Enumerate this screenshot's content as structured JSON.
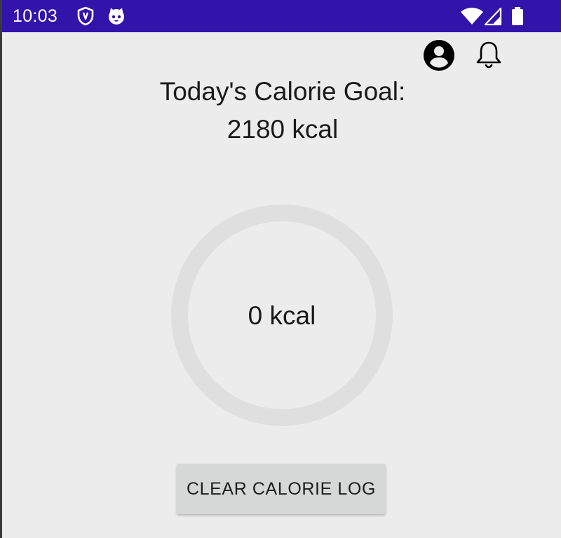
{
  "status_bar": {
    "time": "10:03",
    "background_color": "#3214aa",
    "icons": [
      "shield-icon",
      "cat-face-icon",
      "wifi-icon",
      "cell-signal-icon",
      "battery-icon"
    ]
  },
  "header": {
    "icons": [
      "account-circle-icon",
      "bell-icon"
    ]
  },
  "goal": {
    "title": "Today's Calorie Goal:",
    "value": "2180 kcal"
  },
  "progress": {
    "consumed_label": "0 kcal",
    "consumed_fraction": 0,
    "track_color": "#dfdfdf"
  },
  "actions": {
    "clear_label": "CLEAR CALORIE LOG"
  }
}
